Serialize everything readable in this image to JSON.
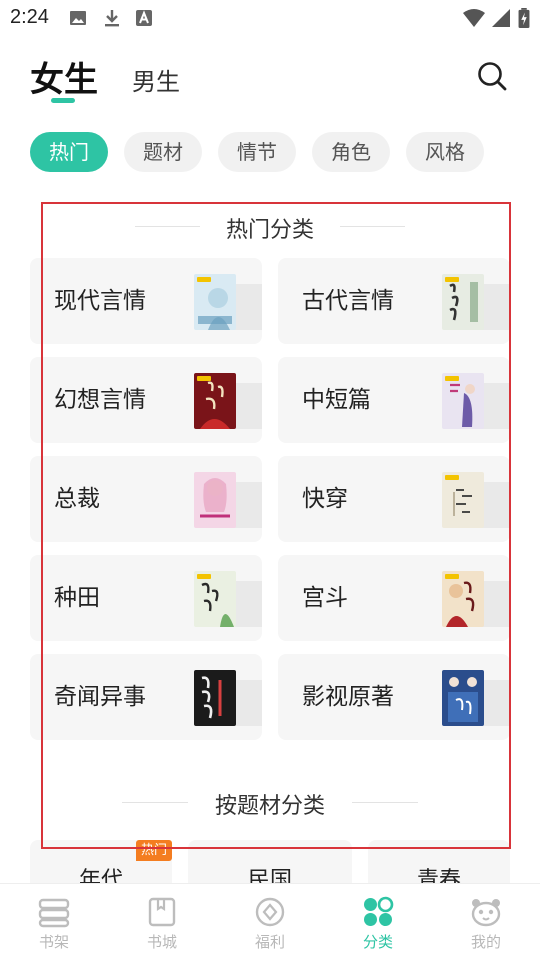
{
  "status_bar": {
    "time": "2:24"
  },
  "gender_tabs": {
    "active": "女生",
    "inactive": "男生"
  },
  "chips": [
    "热门",
    "题材",
    "情节",
    "角色",
    "风格"
  ],
  "hot_section": {
    "title": "热门分类",
    "categories": [
      {
        "label": "现代言情",
        "cover_text": "",
        "cover_color": "#d9eaf3"
      },
      {
        "label": "古代言情",
        "cover_text": "登基后我成了秦始皇",
        "cover_color": "#e7ece3"
      },
      {
        "label": "幻想言情",
        "cover_text": "",
        "cover_color": "#7a1419"
      },
      {
        "label": "中短篇",
        "cover_text": "",
        "cover_color": "#e9e4f1"
      },
      {
        "label": "总裁",
        "cover_text": "",
        "cover_color": "#f4d6e6"
      },
      {
        "label": "快穿",
        "cover_text": "",
        "cover_color": "#efeadc"
      },
      {
        "label": "种田",
        "cover_text": "",
        "cover_color": "#eaf0e2"
      },
      {
        "label": "宫斗",
        "cover_text": "",
        "cover_color": "#f2e2c9"
      },
      {
        "label": "奇闻异事",
        "cover_text": "",
        "cover_color": "#1b1b1b"
      },
      {
        "label": "影视原著",
        "cover_text": "",
        "cover_color": "#2b4d8c"
      }
    ]
  },
  "subject_section": {
    "title": "按题材分类",
    "items": [
      {
        "label": "年代",
        "tag": "热门"
      },
      {
        "label": "民国",
        "tag": ""
      },
      {
        "label": "青春",
        "tag": ""
      }
    ]
  },
  "bottom_nav": [
    {
      "label": "书架",
      "icon": "bookshelf-icon",
      "active": false
    },
    {
      "label": "书城",
      "icon": "bookstore-icon",
      "active": false
    },
    {
      "label": "福利",
      "icon": "welfare-icon",
      "active": false
    },
    {
      "label": "分类",
      "icon": "category-icon",
      "active": true
    },
    {
      "label": "我的",
      "icon": "profile-icon",
      "active": false
    }
  ],
  "colors": {
    "accent": "#2ec4a4",
    "hot_tag": "#f47d20",
    "highlight_box": "#d8343a"
  }
}
